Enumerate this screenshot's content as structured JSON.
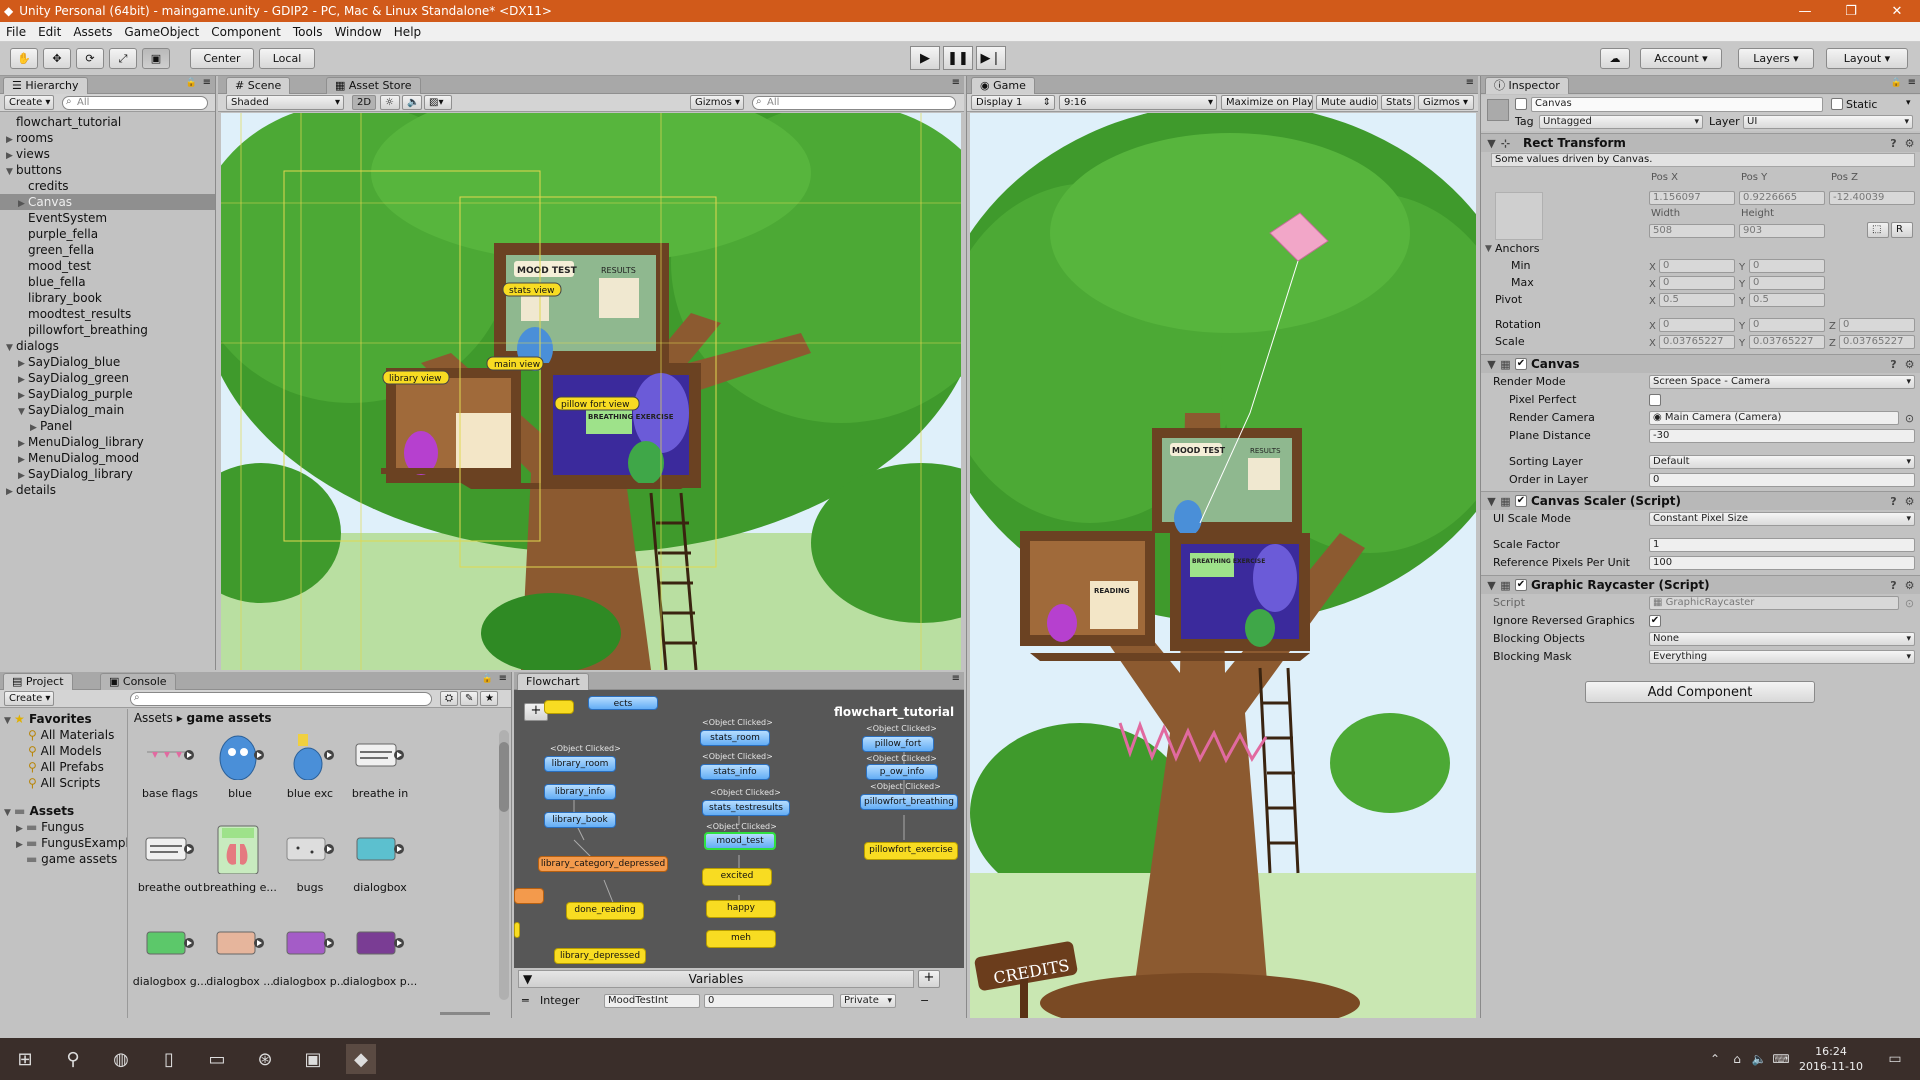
{
  "window": {
    "title": "Unity Personal (64bit) - maingame.unity - GDIP2 - PC, Mac & Linux Standalone* <DX11>"
  },
  "menu": [
    "File",
    "Edit",
    "Assets",
    "GameObject",
    "Component",
    "Tools",
    "Window",
    "Help"
  ],
  "toolbar": {
    "center": "Center",
    "local": "Local",
    "account": "Account",
    "layers": "Layers",
    "layout": "Layout"
  },
  "hierarchy": {
    "tab": "Hierarchy",
    "create": "Create",
    "search_placeholder": "All",
    "rows": [
      {
        "label": "flowchart_tutorial",
        "indent": 0,
        "arrow": ""
      },
      {
        "label": "rooms",
        "indent": 0,
        "arrow": "▶"
      },
      {
        "label": "views",
        "indent": 0,
        "arrow": "▶"
      },
      {
        "label": "buttons",
        "indent": 0,
        "arrow": "▼"
      },
      {
        "label": "credits",
        "indent": 1,
        "arrow": ""
      },
      {
        "label": "Canvas",
        "indent": 1,
        "arrow": "▶",
        "selected": true
      },
      {
        "label": "EventSystem",
        "indent": 1,
        "arrow": ""
      },
      {
        "label": "purple_fella",
        "indent": 1,
        "arrow": ""
      },
      {
        "label": "green_fella",
        "indent": 1,
        "arrow": ""
      },
      {
        "label": "mood_test",
        "indent": 1,
        "arrow": ""
      },
      {
        "label": "blue_fella",
        "indent": 1,
        "arrow": ""
      },
      {
        "label": "library_book",
        "indent": 1,
        "arrow": ""
      },
      {
        "label": "moodtest_results",
        "indent": 1,
        "arrow": ""
      },
      {
        "label": "pillowfort_breathing",
        "indent": 1,
        "arrow": ""
      },
      {
        "label": "dialogs",
        "indent": 0,
        "arrow": "▼"
      },
      {
        "label": "SayDialog_blue",
        "indent": 1,
        "arrow": "▶"
      },
      {
        "label": "SayDialog_green",
        "indent": 1,
        "arrow": "▶"
      },
      {
        "label": "SayDialog_purple",
        "indent": 1,
        "arrow": "▶"
      },
      {
        "label": "SayDialog_main",
        "indent": 1,
        "arrow": "▼"
      },
      {
        "label": "Panel",
        "indent": 2,
        "arrow": "▶"
      },
      {
        "label": "MenuDialog_library",
        "indent": 1,
        "arrow": "▶"
      },
      {
        "label": "MenuDialog_mood",
        "indent": 1,
        "arrow": "▶"
      },
      {
        "label": "SayDialog_library",
        "indent": 1,
        "arrow": "▶"
      },
      {
        "label": "details",
        "indent": 0,
        "arrow": "▶"
      }
    ]
  },
  "scene": {
    "tab": "Scene",
    "asset_store_tab": "Asset Store",
    "shading": "Shaded",
    "mode_2d": "2D",
    "gizmos": "Gizmos",
    "search_placeholder": "All",
    "labels": {
      "mood": "MOOD TEST",
      "results": "RESULTS",
      "stats": "stats view",
      "main": "main view",
      "library": "library view",
      "breathing": "BREATHING EXERCISE",
      "pillow": "pillow fort view",
      "reading": "READING"
    }
  },
  "game": {
    "tab": "Game",
    "display": "Display 1",
    "aspect": "9:16",
    "maximize": "Maximize on Play",
    "mute": "Mute audio",
    "stats": "Stats",
    "gizmos": "Gizmos",
    "credits": "CREDITS",
    "mood": "MOOD TEST",
    "results": "RESULTS",
    "reading": "READING",
    "breathing": "BREATHING EXERCISE"
  },
  "inspector": {
    "tab": "Inspector",
    "name": "Canvas",
    "static": "Static",
    "tag_label": "Tag",
    "tag": "Untagged",
    "layer_label": "Layer",
    "layer": "UI",
    "rect": {
      "title": "Rect Transform",
      "note": "Some values driven by Canvas.",
      "posx_l": "Pos X",
      "posy_l": "Pos Y",
      "posz_l": "Pos Z",
      "posx": "1.156097",
      "posy": "0.9226665",
      "posz": "-12.40039",
      "width_l": "Width",
      "height_l": "Height",
      "width": "508",
      "height": "903",
      "anchors": "Anchors",
      "min": "Min",
      "max": "Max",
      "minx": "0",
      "miny": "0",
      "maxx": "0",
      "maxy": "0",
      "pivot": "Pivot",
      "pivx": "0.5",
      "pivy": "0.5",
      "rotation": "Rotation",
      "rotx": "0",
      "roty": "0",
      "rotz": "0",
      "scale": "Scale",
      "sx": "0.03765227",
      "sy": "0.03765227",
      "sz": "0.03765227",
      "x": "X",
      "y": "Y",
      "z": "Z",
      "r": "R"
    },
    "canvas": {
      "title": "Canvas",
      "render_mode_l": "Render Mode",
      "render_mode": "Screen Space - Camera",
      "pixel_perfect_l": "Pixel Perfect",
      "render_camera_l": "Render Camera",
      "render_camera": "Main Camera (Camera)",
      "plane_distance_l": "Plane Distance",
      "plane_distance": "-30",
      "sorting_layer_l": "Sorting Layer",
      "sorting_layer": "Default",
      "order_l": "Order in Layer",
      "order": "0"
    },
    "scaler": {
      "title": "Canvas Scaler (Script)",
      "ui_scale_l": "UI Scale Mode",
      "ui_scale": "Constant Pixel Size",
      "scale_factor_l": "Scale Factor",
      "scale_factor": "1",
      "ref_l": "Reference Pixels Per Unit",
      "ref": "100"
    },
    "raycaster": {
      "title": "Graphic Raycaster (Script)",
      "script_l": "Script",
      "script": "GraphicRaycaster",
      "ignore_l": "Ignore Reversed Graphics",
      "blocking_l": "Blocking Objects",
      "blocking": "None",
      "mask_l": "Blocking Mask",
      "mask": "Everything"
    },
    "add_component": "Add Component"
  },
  "project": {
    "tab": "Project",
    "console_tab": "Console",
    "create": "Create",
    "favorites": "Favorites",
    "fav_items": [
      "All Materials",
      "All Models",
      "All Prefabs",
      "All Scripts"
    ],
    "assets": "Assets",
    "asset_folders": [
      "Fungus",
      "FungusExampl",
      "game assets"
    ],
    "breadcrumb_root": "Assets",
    "breadcrumb_leaf": "game assets",
    "items": [
      {
        "name": "base flags",
        "kind": "flags"
      },
      {
        "name": "blue",
        "kind": "blue"
      },
      {
        "name": "blue exc",
        "kind": "bluesmall"
      },
      {
        "name": "breathe in",
        "kind": "breathein"
      },
      {
        "name": "breathe out",
        "kind": "breatheout"
      },
      {
        "name": "breathing e...",
        "kind": "breathing"
      },
      {
        "name": "bugs",
        "kind": "bugs"
      },
      {
        "name": "dialogbox",
        "kind": "box",
        "color": "#5cc0cf"
      },
      {
        "name": "dialogbox g...",
        "kind": "box",
        "color": "#5cc86a"
      },
      {
        "name": "dialogbox ...",
        "kind": "box",
        "color": "#e6b59c"
      },
      {
        "name": "dialogbox p...",
        "kind": "box",
        "color": "#a45cc7"
      },
      {
        "name": "dialogbox p...",
        "kind": "box",
        "color": "#7a3d94"
      }
    ]
  },
  "flowchart": {
    "tab": "Flowchart",
    "title": "flowchart_tutorial",
    "add": "+",
    "variables": "Variables",
    "var_type": "Integer",
    "var_name": "MoodTestInt",
    "var_value": "0",
    "var_scope": "Private",
    "events": [
      "<Object Clicked>",
      "<Object Clicked>",
      "<Object Clicked>",
      "<Object Clicked>",
      "<Object Clicked>",
      "<Object Clicked>",
      "<Object Clicked>",
      "<Object Clicked>",
      "<Object Clicked>"
    ],
    "nodes": [
      "library_room",
      "library_info",
      "library_book",
      "library_category_depressed",
      "done_reading",
      "library_depressed",
      "stats_room",
      "stats_info",
      "stats_testresults",
      "mood_test",
      "excited",
      "happy",
      "meh",
      "pillow_fort",
      "p_ow_info",
      "pillowfort_breathing",
      "pillowfort_exercise",
      "ects"
    ]
  },
  "taskbar": {
    "time": "16:24",
    "date": "2016-11-10"
  },
  "colors": {
    "title": "#d15a1a",
    "sky": "#dff0fa",
    "leaf": "#3f9a2c",
    "trunk": "#8c5a30"
  }
}
